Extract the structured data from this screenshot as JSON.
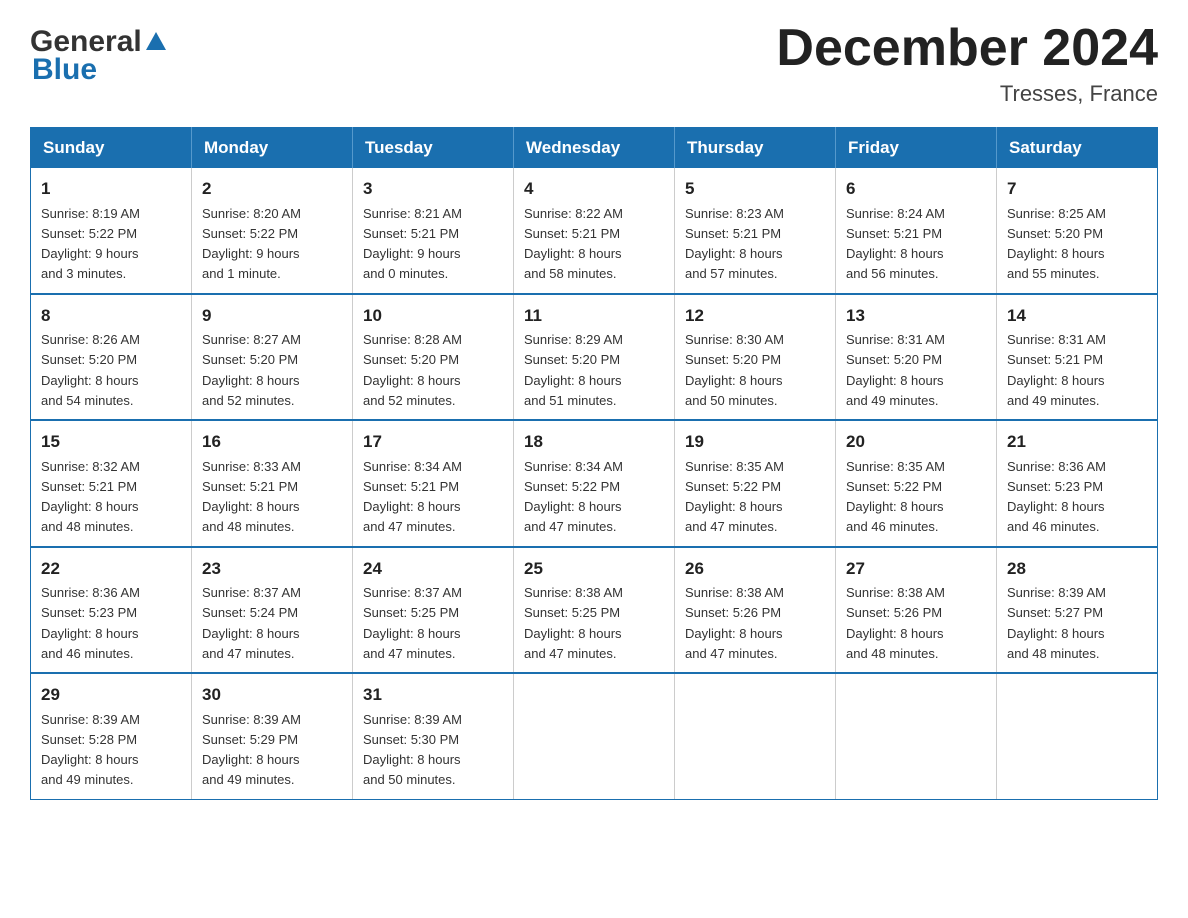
{
  "header": {
    "logo_general": "General",
    "logo_blue": "Blue",
    "month_title": "December 2024",
    "location": "Tresses, France"
  },
  "weekdays": [
    "Sunday",
    "Monday",
    "Tuesday",
    "Wednesday",
    "Thursday",
    "Friday",
    "Saturday"
  ],
  "weeks": [
    [
      {
        "day": "1",
        "sunrise": "Sunrise: 8:19 AM",
        "sunset": "Sunset: 5:22 PM",
        "daylight": "Daylight: 9 hours",
        "daylight2": "and 3 minutes."
      },
      {
        "day": "2",
        "sunrise": "Sunrise: 8:20 AM",
        "sunset": "Sunset: 5:22 PM",
        "daylight": "Daylight: 9 hours",
        "daylight2": "and 1 minute."
      },
      {
        "day": "3",
        "sunrise": "Sunrise: 8:21 AM",
        "sunset": "Sunset: 5:21 PM",
        "daylight": "Daylight: 9 hours",
        "daylight2": "and 0 minutes."
      },
      {
        "day": "4",
        "sunrise": "Sunrise: 8:22 AM",
        "sunset": "Sunset: 5:21 PM",
        "daylight": "Daylight: 8 hours",
        "daylight2": "and 58 minutes."
      },
      {
        "day": "5",
        "sunrise": "Sunrise: 8:23 AM",
        "sunset": "Sunset: 5:21 PM",
        "daylight": "Daylight: 8 hours",
        "daylight2": "and 57 minutes."
      },
      {
        "day": "6",
        "sunrise": "Sunrise: 8:24 AM",
        "sunset": "Sunset: 5:21 PM",
        "daylight": "Daylight: 8 hours",
        "daylight2": "and 56 minutes."
      },
      {
        "day": "7",
        "sunrise": "Sunrise: 8:25 AM",
        "sunset": "Sunset: 5:20 PM",
        "daylight": "Daylight: 8 hours",
        "daylight2": "and 55 minutes."
      }
    ],
    [
      {
        "day": "8",
        "sunrise": "Sunrise: 8:26 AM",
        "sunset": "Sunset: 5:20 PM",
        "daylight": "Daylight: 8 hours",
        "daylight2": "and 54 minutes."
      },
      {
        "day": "9",
        "sunrise": "Sunrise: 8:27 AM",
        "sunset": "Sunset: 5:20 PM",
        "daylight": "Daylight: 8 hours",
        "daylight2": "and 52 minutes."
      },
      {
        "day": "10",
        "sunrise": "Sunrise: 8:28 AM",
        "sunset": "Sunset: 5:20 PM",
        "daylight": "Daylight: 8 hours",
        "daylight2": "and 52 minutes."
      },
      {
        "day": "11",
        "sunrise": "Sunrise: 8:29 AM",
        "sunset": "Sunset: 5:20 PM",
        "daylight": "Daylight: 8 hours",
        "daylight2": "and 51 minutes."
      },
      {
        "day": "12",
        "sunrise": "Sunrise: 8:30 AM",
        "sunset": "Sunset: 5:20 PM",
        "daylight": "Daylight: 8 hours",
        "daylight2": "and 50 minutes."
      },
      {
        "day": "13",
        "sunrise": "Sunrise: 8:31 AM",
        "sunset": "Sunset: 5:20 PM",
        "daylight": "Daylight: 8 hours",
        "daylight2": "and 49 minutes."
      },
      {
        "day": "14",
        "sunrise": "Sunrise: 8:31 AM",
        "sunset": "Sunset: 5:21 PM",
        "daylight": "Daylight: 8 hours",
        "daylight2": "and 49 minutes."
      }
    ],
    [
      {
        "day": "15",
        "sunrise": "Sunrise: 8:32 AM",
        "sunset": "Sunset: 5:21 PM",
        "daylight": "Daylight: 8 hours",
        "daylight2": "and 48 minutes."
      },
      {
        "day": "16",
        "sunrise": "Sunrise: 8:33 AM",
        "sunset": "Sunset: 5:21 PM",
        "daylight": "Daylight: 8 hours",
        "daylight2": "and 48 minutes."
      },
      {
        "day": "17",
        "sunrise": "Sunrise: 8:34 AM",
        "sunset": "Sunset: 5:21 PM",
        "daylight": "Daylight: 8 hours",
        "daylight2": "and 47 minutes."
      },
      {
        "day": "18",
        "sunrise": "Sunrise: 8:34 AM",
        "sunset": "Sunset: 5:22 PM",
        "daylight": "Daylight: 8 hours",
        "daylight2": "and 47 minutes."
      },
      {
        "day": "19",
        "sunrise": "Sunrise: 8:35 AM",
        "sunset": "Sunset: 5:22 PM",
        "daylight": "Daylight: 8 hours",
        "daylight2": "and 47 minutes."
      },
      {
        "day": "20",
        "sunrise": "Sunrise: 8:35 AM",
        "sunset": "Sunset: 5:22 PM",
        "daylight": "Daylight: 8 hours",
        "daylight2": "and 46 minutes."
      },
      {
        "day": "21",
        "sunrise": "Sunrise: 8:36 AM",
        "sunset": "Sunset: 5:23 PM",
        "daylight": "Daylight: 8 hours",
        "daylight2": "and 46 minutes."
      }
    ],
    [
      {
        "day": "22",
        "sunrise": "Sunrise: 8:36 AM",
        "sunset": "Sunset: 5:23 PM",
        "daylight": "Daylight: 8 hours",
        "daylight2": "and 46 minutes."
      },
      {
        "day": "23",
        "sunrise": "Sunrise: 8:37 AM",
        "sunset": "Sunset: 5:24 PM",
        "daylight": "Daylight: 8 hours",
        "daylight2": "and 47 minutes."
      },
      {
        "day": "24",
        "sunrise": "Sunrise: 8:37 AM",
        "sunset": "Sunset: 5:25 PM",
        "daylight": "Daylight: 8 hours",
        "daylight2": "and 47 minutes."
      },
      {
        "day": "25",
        "sunrise": "Sunrise: 8:38 AM",
        "sunset": "Sunset: 5:25 PM",
        "daylight": "Daylight: 8 hours",
        "daylight2": "and 47 minutes."
      },
      {
        "day": "26",
        "sunrise": "Sunrise: 8:38 AM",
        "sunset": "Sunset: 5:26 PM",
        "daylight": "Daylight: 8 hours",
        "daylight2": "and 47 minutes."
      },
      {
        "day": "27",
        "sunrise": "Sunrise: 8:38 AM",
        "sunset": "Sunset: 5:26 PM",
        "daylight": "Daylight: 8 hours",
        "daylight2": "and 48 minutes."
      },
      {
        "day": "28",
        "sunrise": "Sunrise: 8:39 AM",
        "sunset": "Sunset: 5:27 PM",
        "daylight": "Daylight: 8 hours",
        "daylight2": "and 48 minutes."
      }
    ],
    [
      {
        "day": "29",
        "sunrise": "Sunrise: 8:39 AM",
        "sunset": "Sunset: 5:28 PM",
        "daylight": "Daylight: 8 hours",
        "daylight2": "and 49 minutes."
      },
      {
        "day": "30",
        "sunrise": "Sunrise: 8:39 AM",
        "sunset": "Sunset: 5:29 PM",
        "daylight": "Daylight: 8 hours",
        "daylight2": "and 49 minutes."
      },
      {
        "day": "31",
        "sunrise": "Sunrise: 8:39 AM",
        "sunset": "Sunset: 5:30 PM",
        "daylight": "Daylight: 8 hours",
        "daylight2": "and 50 minutes."
      },
      null,
      null,
      null,
      null
    ]
  ]
}
